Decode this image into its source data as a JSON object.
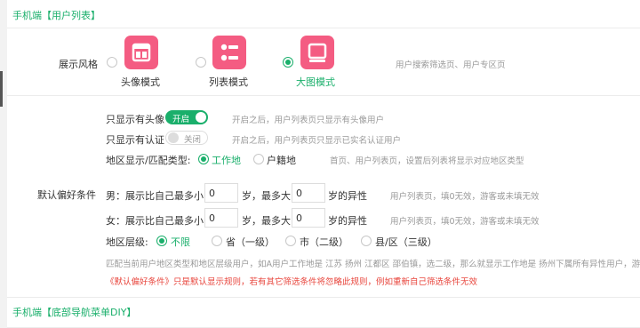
{
  "section1": {
    "title": "手机端【用户列表】"
  },
  "section2": {
    "title": "手机端【底部导航菜单DIY】"
  },
  "display_style": {
    "label": "展示风格",
    "options": [
      {
        "label": "头像模式",
        "selected": false
      },
      {
        "label": "列表模式",
        "selected": false
      },
      {
        "label": "大图模式",
        "selected": true
      }
    ],
    "hint": "用户搜索筛选页、用户专区页"
  },
  "defaults": {
    "label": "默认偏好条件",
    "only_avatar": {
      "label": "只显示有头像",
      "toggle": "开启",
      "hint": "开启之后，用户列表页只显示有头像用户"
    },
    "only_verified": {
      "label": "只显示有认证",
      "toggle": "关闭",
      "hint": "开启之后，用户列表页只显示已实名认证用户"
    },
    "region_type": {
      "label": "地区显示/匹配类型:",
      "options": [
        {
          "label": "工作地",
          "selected": true
        },
        {
          "label": "户籍地",
          "selected": false
        }
      ],
      "hint": "首页、用户列表页，设置后列表将显示对应地区类型"
    },
    "male": {
      "prefix": "男：展示比自己最多小",
      "min_value": "0",
      "mid": "岁，最多大",
      "max_value": "0",
      "suffix": "岁的异性",
      "hint": "用户列表页，填0无效，游客或未填无效"
    },
    "female": {
      "prefix": "女：展示比自己最多小",
      "min_value": "0",
      "mid": "岁，最多大",
      "max_value": "0",
      "suffix": "岁的异性",
      "hint": "用户列表页，填0无效，游客或未填无效"
    },
    "region_level": {
      "label": "地区层级:",
      "options": [
        {
          "label": "不限",
          "selected": true
        },
        {
          "label": "省（一级）",
          "selected": false
        },
        {
          "label": "市（二级）",
          "selected": false
        },
        {
          "label": "县/区（三级）",
          "selected": false
        }
      ]
    },
    "note": "匹配当前用户地区类型和地区层级用户，如A用户工作地是 江苏 扬州 江都区 邵伯镇，选二级，那么就显示工作地是 扬州下属所有异性用户，游客或未",
    "warning": "《默认偏好条件》只是默认显示规则，若有其它筛选条件将忽略此规则，例如重新自己筛选条件无效"
  }
}
